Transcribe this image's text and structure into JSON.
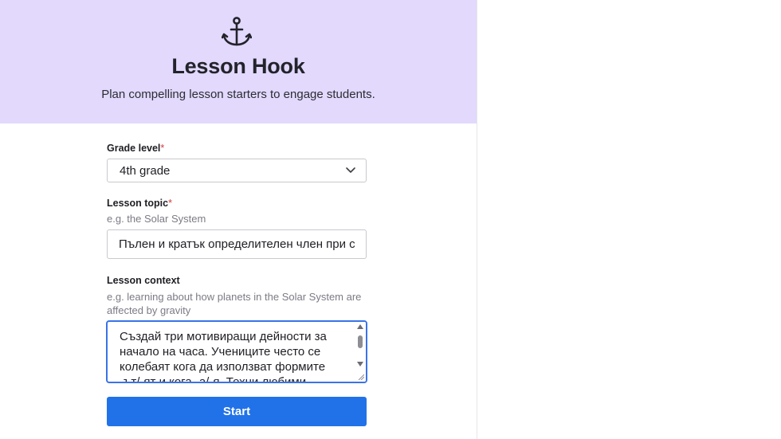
{
  "hero": {
    "icon": "anchor-icon",
    "title": "Lesson Hook",
    "subtitle": "Plan compelling lesson starters to engage students."
  },
  "form": {
    "grade": {
      "label": "Grade level",
      "required_mark": "*",
      "value": "4th grade",
      "icon": "chevron-down-icon"
    },
    "topic": {
      "label": "Lesson topic",
      "required_mark": "*",
      "placeholder": "e.g. the Solar System",
      "value": "Пълен и кратък определителен член при с"
    },
    "context": {
      "label": "Lesson context",
      "placeholder": "e.g. learning about how planets in the Solar System are affected by gravity",
      "value": "Създай три мотивиращи дейности за начало на часа. Учениците често се колебаят кога да използват формите -ът/-ят и кога -а/-я. Техни любими"
    },
    "submit_label": "Start"
  },
  "colors": {
    "hero_bg": "#e2d9fd",
    "primary": "#2172e8",
    "required": "#d23b3b",
    "focus_border": "#3a73e8"
  }
}
